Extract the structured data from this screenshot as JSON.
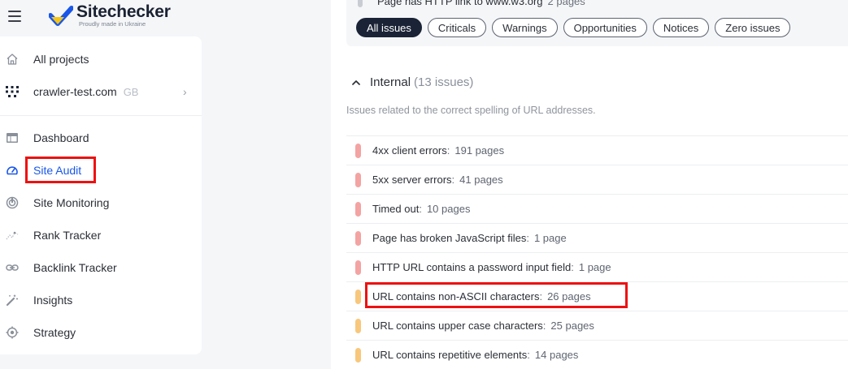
{
  "brand": {
    "name": "Sitechecker",
    "tagline": "Proudly made in Ukraine",
    "colors": {
      "blue": "#1a57e8",
      "yellow": "#f5c518"
    }
  },
  "sidebar": {
    "projects_label": "All projects",
    "project": {
      "name": "crawler-test.com",
      "region": "GB"
    },
    "items": [
      {
        "label": "Dashboard",
        "icon": "dashboard-icon"
      },
      {
        "label": "Site Audit",
        "icon": "gauge-icon",
        "active": true
      },
      {
        "label": "Site Monitoring",
        "icon": "monitoring-icon"
      },
      {
        "label": "Rank Tracker",
        "icon": "rank-tracker-icon"
      },
      {
        "label": "Backlink Tracker",
        "icon": "link-icon"
      },
      {
        "label": "Insights",
        "icon": "magic-wand-icon"
      },
      {
        "label": "Strategy",
        "icon": "target-icon"
      }
    ]
  },
  "filters": {
    "cut_row": {
      "text": "Page has HTTP link to www.w3.org",
      "count": "2 pages"
    },
    "pills": [
      "All issues",
      "Criticals",
      "Warnings",
      "Opportunities",
      "Notices",
      "Zero issues"
    ],
    "active": "All issues"
  },
  "section": {
    "title": "Internal",
    "count": "(13 issues)",
    "description": "Issues related to the correct spelling of URL addresses."
  },
  "issues": [
    {
      "text": "4xx client errors",
      "count": "191 pages",
      "severity": "critical",
      "color": "#f4a3a3"
    },
    {
      "text": "5xx server errors",
      "count": "41 pages",
      "severity": "critical",
      "color": "#f4a3a3"
    },
    {
      "text": "Timed out",
      "count": "10 pages",
      "severity": "critical",
      "color": "#f4a3a3"
    },
    {
      "text": "Page has broken JavaScript files",
      "count": "1 page",
      "severity": "critical",
      "color": "#f4a3a3"
    },
    {
      "text": "HTTP URL contains a password input field",
      "count": "1 page",
      "severity": "critical",
      "color": "#f4a3a3"
    },
    {
      "text": "URL contains non-ASCII characters",
      "count": "26 pages",
      "severity": "warning",
      "color": "#f8c77c"
    },
    {
      "text": "URL contains upper case characters",
      "count": "25 pages",
      "severity": "warning",
      "color": "#f8c77c"
    },
    {
      "text": "URL contains repetitive elements",
      "count": "14 pages",
      "severity": "warning",
      "color": "#f8c77c"
    }
  ]
}
